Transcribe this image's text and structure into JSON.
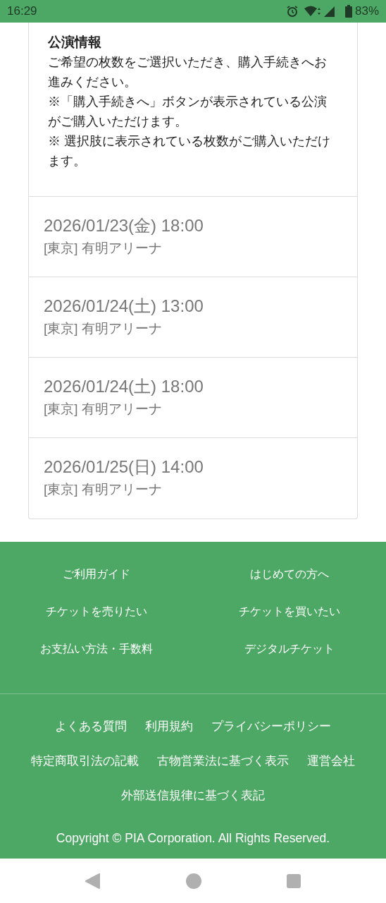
{
  "status_bar": {
    "time": "16:29",
    "battery": "83%"
  },
  "info": {
    "title": "公演情報",
    "paragraphs": [
      "ご希望の枚数をご選択いただき、購入手続きへお進みください。",
      "※「購入手続きへ」ボタンが表示されている公演がご購入いただけます。",
      "※ 選択肢に表示されている枚数がご購入いただけます。"
    ]
  },
  "performances": [
    {
      "datetime": "2026/01/23(金) 18:00",
      "venue": "[東京] 有明アリーナ"
    },
    {
      "datetime": "2026/01/24(土) 13:00",
      "venue": "[東京] 有明アリーナ"
    },
    {
      "datetime": "2026/01/24(土) 18:00",
      "venue": "[東京] 有明アリーナ"
    },
    {
      "datetime": "2026/01/25(日) 14:00",
      "venue": "[東京] 有明アリーナ"
    }
  ],
  "footer": {
    "primary_links": [
      "ご利用ガイド",
      "はじめての方へ",
      "チケットを売りたい",
      "チケットを買いたい",
      "お支払い方法・手数料",
      "デジタルチケット"
    ],
    "secondary_links": [
      [
        "よくある質問",
        "利用規約",
        "プライバシーポリシー"
      ],
      [
        "特定商取引法の記載",
        "古物営業法に基づく表示",
        "運営会社"
      ],
      [
        "外部送信規律に基づく表記"
      ]
    ],
    "copyright": "Copyright © PIA Corporation. All Rights Reserved."
  }
}
